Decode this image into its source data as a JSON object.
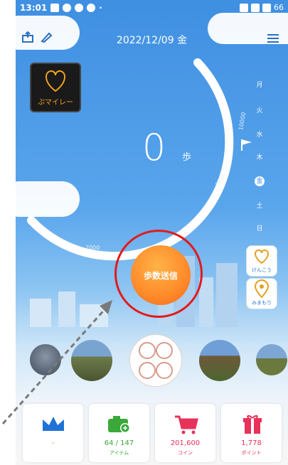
{
  "status_bar": {
    "time": "13:01",
    "battery": "66"
  },
  "header": {
    "date": "2022/12/09 金"
  },
  "logo": {
    "text": "ぷマイレー"
  },
  "weekdays": [
    "月",
    "火",
    "水",
    "木",
    "金",
    "土",
    "日"
  ],
  "steps": {
    "value": "0",
    "unit": "歩"
  },
  "scale_labels": [
    "10000",
    "6000",
    "2000"
  ],
  "send_button": {
    "label": "歩数送信"
  },
  "side_buttons": [
    {
      "label": "けんこう"
    },
    {
      "label": "みまもり"
    }
  ],
  "cards": [
    {
      "value": "-",
      "label": ""
    },
    {
      "value": "64 / 147",
      "label": "アイテム"
    },
    {
      "value": "201,600",
      "label": "コイン"
    },
    {
      "value": "1,778",
      "label": "ポイント"
    }
  ],
  "colors": {
    "sky": "#3f8fe2",
    "accent_orange": "#ff8a2a",
    "highlight_ring": "#e21b1b",
    "crown": "#1e72d6",
    "camera": "#3aa93a",
    "cart": "#e8325a",
    "gift": "#e8325a"
  }
}
